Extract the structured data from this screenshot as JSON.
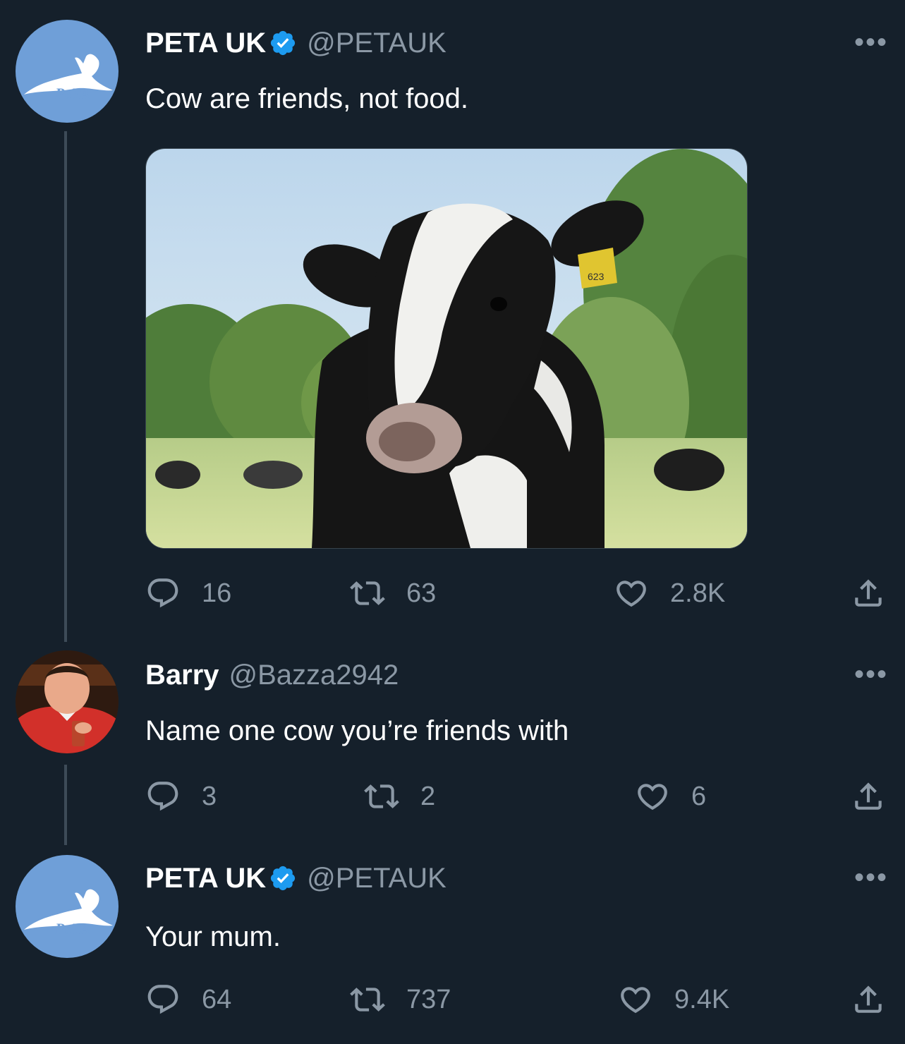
{
  "tweet1": {
    "name": "PETA UK",
    "handle": "@PETAUK",
    "text": "Cow are friends, not food.",
    "avatar_text": "PeTA",
    "image_tag": "623",
    "replies": "16",
    "retweets": "63",
    "likes": "2.8K"
  },
  "tweet2": {
    "name": "Barry",
    "handle": "@Bazza2942",
    "text": "Name one cow you’re friends with",
    "replies": "3",
    "retweets": "2",
    "likes": "6"
  },
  "tweet3": {
    "name": "PETA UK",
    "handle": "@PETAUK",
    "text": "Your mum.",
    "avatar_text": "PeTA",
    "replies": "64",
    "retweets": "737",
    "likes": "9.4K"
  },
  "more_label": "•••",
  "colors": {
    "background": "#15202b",
    "secondary_text": "#8b98a5",
    "verified": "#1d9bf0",
    "peta_avatar": "#6f9fd8"
  }
}
